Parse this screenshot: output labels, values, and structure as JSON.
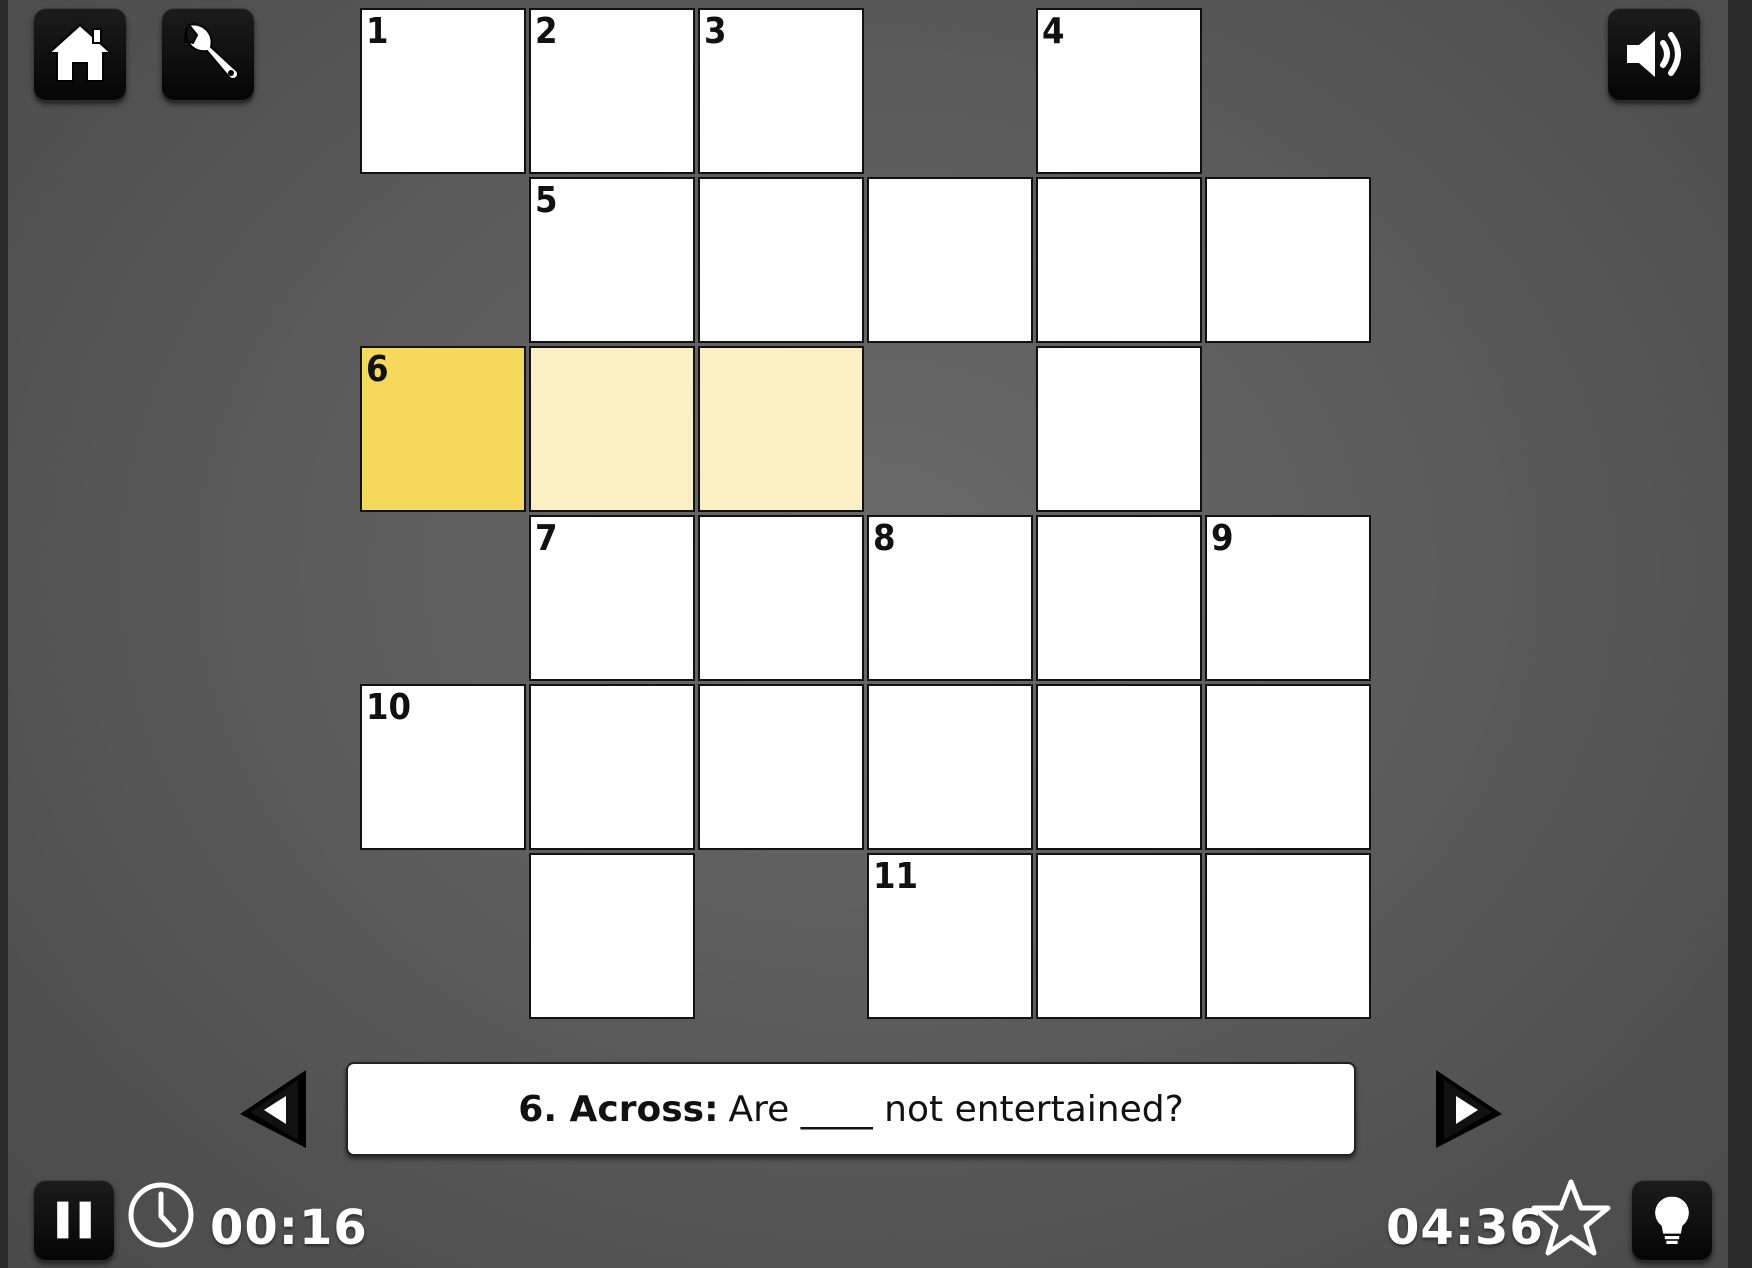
{
  "toolbar": {
    "home_icon": "home-icon",
    "settings_icon": "wrench-icon",
    "sound_icon": "speaker-icon"
  },
  "grid": {
    "cells": [
      {
        "row": 0,
        "col": 0,
        "num": "1"
      },
      {
        "row": 0,
        "col": 1,
        "num": "2"
      },
      {
        "row": 0,
        "col": 2,
        "num": "3"
      },
      {
        "row": 0,
        "col": 4,
        "num": "4"
      },
      {
        "row": 1,
        "col": 1,
        "num": "5"
      },
      {
        "row": 1,
        "col": 2,
        "num": ""
      },
      {
        "row": 1,
        "col": 3,
        "num": ""
      },
      {
        "row": 1,
        "col": 4,
        "num": ""
      },
      {
        "row": 1,
        "col": 5,
        "num": ""
      },
      {
        "row": 2,
        "col": 0,
        "num": "6",
        "state": "active"
      },
      {
        "row": 2,
        "col": 1,
        "num": "",
        "state": "word"
      },
      {
        "row": 2,
        "col": 2,
        "num": "",
        "state": "word"
      },
      {
        "row": 2,
        "col": 4,
        "num": ""
      },
      {
        "row": 3,
        "col": 1,
        "num": "7"
      },
      {
        "row": 3,
        "col": 2,
        "num": ""
      },
      {
        "row": 3,
        "col": 3,
        "num": "8"
      },
      {
        "row": 3,
        "col": 4,
        "num": ""
      },
      {
        "row": 3,
        "col": 5,
        "num": "9"
      },
      {
        "row": 4,
        "col": 0,
        "num": "10"
      },
      {
        "row": 4,
        "col": 1,
        "num": ""
      },
      {
        "row": 4,
        "col": 2,
        "num": ""
      },
      {
        "row": 4,
        "col": 3,
        "num": ""
      },
      {
        "row": 4,
        "col": 4,
        "num": ""
      },
      {
        "row": 4,
        "col": 5,
        "num": ""
      },
      {
        "row": 5,
        "col": 1,
        "num": ""
      },
      {
        "row": 5,
        "col": 3,
        "num": "11"
      },
      {
        "row": 5,
        "col": 4,
        "num": ""
      },
      {
        "row": 5,
        "col": 5,
        "num": ""
      }
    ],
    "colors": {
      "cell": "#ffffff",
      "active": "#f5d95a",
      "word": "#fbefc4"
    }
  },
  "clue": {
    "label": "6. Across:",
    "text": "Are ____ not entertained?"
  },
  "status": {
    "elapsed": "00:16",
    "remaining": "04:36",
    "pause_icon": "pause-icon",
    "clock_icon": "clock-icon",
    "star_icon": "star-icon",
    "hint_icon": "lightbulb-icon"
  }
}
